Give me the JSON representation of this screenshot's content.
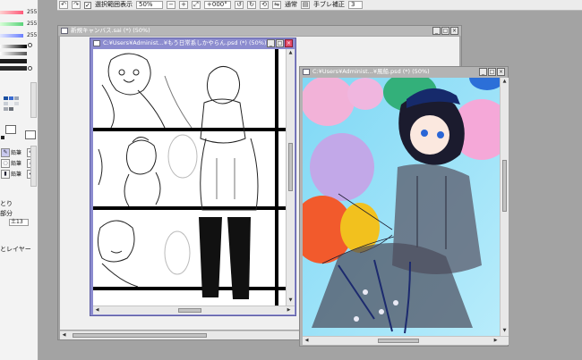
{
  "toolbar": {
    "select_area_checked": "✓",
    "select_area_label": "選択範囲表示",
    "zoom_value": "50%",
    "rotate_value": "+000°",
    "blend_mode": "通常",
    "stabilizer_label": "手ブレ補正",
    "stabilizer_value": "3"
  },
  "left_panel": {
    "rgb_values": [
      "255",
      "255",
      "255"
    ],
    "tool_labels": [
      "鉛筆",
      "鉛筆",
      "鉛筆"
    ],
    "label_1": "とり",
    "label_2": "部分",
    "field_value": "土13",
    "layer_label": "とレイヤー",
    "palette_colors": [
      "#1a4fa0",
      "#3a6bd1",
      "#9aa6b8",
      "#c9ced6",
      "#eef0f4",
      "#d6d9de",
      "#a4a9b1",
      "#6a6f78"
    ]
  },
  "windows": {
    "background": {
      "title": "新規キャンバス.sai (*) (50%)"
    },
    "manga": {
      "title": "C:¥Users¥Administ...¥もう日常系しかやらん.psd (*) (50%)"
    },
    "color": {
      "title": "C:¥Users¥Administ...¥風船.psd (*) (50%)"
    }
  },
  "colors": {
    "active_title": "#8c8ccf",
    "inactive_title": "#b3b3b3",
    "canvas_bg": "#a3a3a3"
  }
}
